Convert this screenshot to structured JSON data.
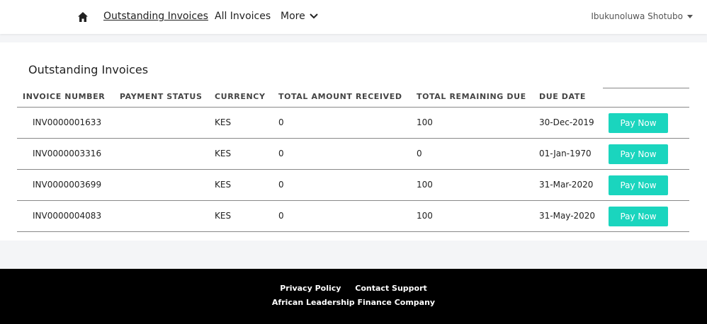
{
  "nav": {
    "home_icon": "home-icon",
    "links": [
      {
        "label": "Outstanding Invoices",
        "active": true
      },
      {
        "label": "All Invoices",
        "active": false
      },
      {
        "label": "More",
        "active": false
      }
    ],
    "user_name": "Ibukunoluwa Shotubo"
  },
  "main": {
    "title": "Outstanding Invoices",
    "columns": [
      "INVOICE NUMBER",
      "PAYMENT STATUS",
      "CURRENCY",
      "TOTAL AMOUNT RECEIVED",
      "TOTAL REMAINING DUE",
      "DUE DATE"
    ],
    "rows": [
      {
        "invoice": "INV0000001633",
        "status": "",
        "currency": "KES",
        "received": "0",
        "remaining": "100",
        "due": "30-Dec-2019",
        "action": "Pay Now"
      },
      {
        "invoice": "INV0000003316",
        "status": "",
        "currency": "KES",
        "received": "0",
        "remaining": "0",
        "due": "01-Jan-1970",
        "action": "Pay Now"
      },
      {
        "invoice": "INV0000003699",
        "status": "",
        "currency": "KES",
        "received": "0",
        "remaining": "100",
        "due": "31-Mar-2020",
        "action": "Pay Now"
      },
      {
        "invoice": "INV0000004083",
        "status": "",
        "currency": "KES",
        "received": "0",
        "remaining": "100",
        "due": "31-May-2020",
        "action": "Pay Now"
      }
    ]
  },
  "footer": {
    "privacy": "Privacy Policy",
    "support": "Contact Support",
    "company": "African Leadership Finance Company"
  },
  "colors": {
    "accent": "#1ad5be",
    "footer_bg": "#000000",
    "page_bg": "#f4f5f7"
  }
}
